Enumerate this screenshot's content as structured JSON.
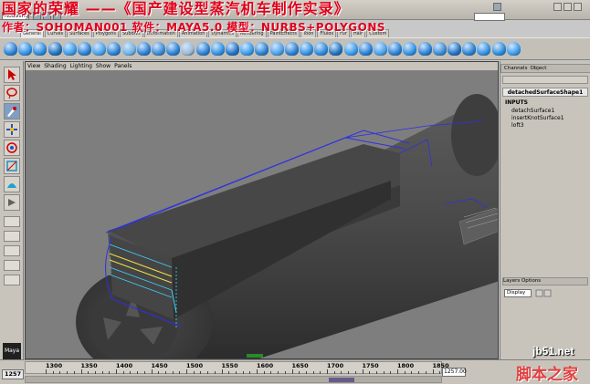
{
  "title": {
    "line1": "国家的荣耀 ——《国产建设型蒸汽机车制作实录》",
    "line2": "作者：SOHOMAN001   软件：MAYA5.0   模型：NURBS+POLYGONS"
  },
  "top": {
    "mode": "Modeling"
  },
  "shelf_tabs": [
    "General",
    "Curves",
    "Surfaces",
    "Polygons",
    "Subdivs",
    "Deformation",
    "Animation",
    "Dynamics",
    "Rendering",
    "PaintEffects",
    "Toon",
    "Fluids",
    "Fur",
    "Hair",
    "Custom"
  ],
  "viewport": {
    "menu": [
      "View",
      "Shading",
      "Lighting",
      "Show",
      "Panels"
    ]
  },
  "channel_box": {
    "menu": [
      "Channels",
      "Object"
    ],
    "shape_name": "detachedSurfaceShape1",
    "inputs_label": "INPUTS",
    "nodes": [
      "detachSurface1",
      "insertKnotSurface1",
      "loft3"
    ],
    "layers_menu": "Layers  Options",
    "layers_select": "Display"
  },
  "timeslider": {
    "start": "1257",
    "end": "1257.00",
    "ticks": [
      "1300",
      "1350",
      "1400",
      "1450",
      "1500",
      "1550",
      "1600",
      "1650",
      "1700",
      "1750",
      "1800",
      "1850"
    ]
  },
  "watermark": {
    "domain": "jb51.net",
    "site": "脚本之家"
  },
  "logo": "Maya",
  "colors": {
    "title_red": "#e0001a",
    "viewport_bg": "#7e7e7e",
    "wire_blue": "#3030e0",
    "wire_cyan": "#40d0ff",
    "wire_yellow": "#f0e040"
  }
}
